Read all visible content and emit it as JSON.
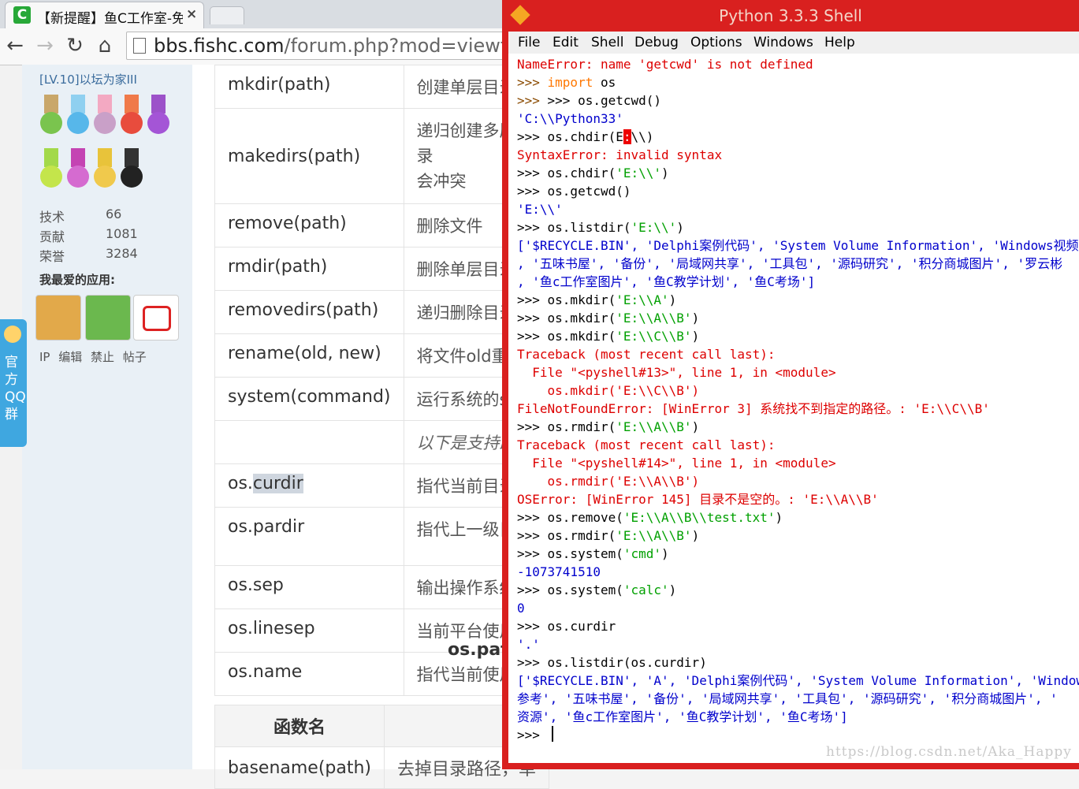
{
  "browser": {
    "tab": {
      "icon": "C",
      "title": "【新提醒】鱼C工作室-免费",
      "close": "×"
    },
    "toolbar": {
      "back": "←",
      "forward": "→",
      "reload": "↻",
      "home": "⌂"
    },
    "url": {
      "host": "bbs.fishc.com",
      "path": "/forum.php?mod=viewthread"
    }
  },
  "sidebar": {
    "level": "[LV.10]以坛为家III",
    "stats": [
      {
        "label": "技术",
        "value": "66"
      },
      {
        "label": "贡献",
        "value": "1081"
      },
      {
        "label": "荣誉",
        "value": "3284"
      }
    ],
    "apps_heading": "我最爱的应用:",
    "links": "IP 编辑 禁止 帖子",
    "qq_label": "官方QQ群"
  },
  "main": {
    "rows": [
      {
        "name": "mkdir(path)",
        "desc": "创建单层目录"
      },
      {
        "name": "makedirs(path)",
        "desc": "递归创建多层目录"
      },
      {
        "name": "remove(path)",
        "desc": "删除文件"
      },
      {
        "name": "rmdir(path)",
        "desc": "删除单层目录"
      },
      {
        "name": "removedirs(path)",
        "desc": "递归删除目录"
      },
      {
        "name": "rename(old, new)",
        "desc": "将文件old重命名"
      },
      {
        "name": "system(command)",
        "desc": "运行系统的shell"
      },
      {
        "name": "",
        "desc": "以下是支持路径"
      },
      {
        "name_prefix": "os.",
        "name_hl": "curdir",
        "desc": "指代当前目录"
      },
      {
        "name": "os.pardir",
        "desc": "指代上一级目录"
      },
      {
        "name": "os.sep",
        "desc": "输出操作系统特"
      },
      {
        "name": "os.linesep",
        "desc": "当前平台使用的"
      },
      {
        "name": "os.name",
        "desc": "指代当前使用的"
      }
    ],
    "section_label": "os.pat",
    "table2": {
      "header_name": "函数名",
      "row_name": "basename(path)",
      "row_desc": "去掉目录路径，单"
    }
  },
  "shell": {
    "title": "Python 3.3.3 Shell",
    "menu": [
      "File",
      "Edit",
      "Shell",
      "Debug",
      "Options",
      "Windows",
      "Help"
    ],
    "lines": {
      "l0": "NameError: name 'getcwd' is not defined",
      "l1a": ">>> ",
      "l1b": "import",
      "l1c": " os",
      "l2": ">>> os.getcwd()",
      "l3": "'C:\\\\Python33'",
      "l4a": ">>> os.chdir(E",
      "l4b": ":",
      "l4c": "\\\\)",
      "l5": "SyntaxError: invalid syntax",
      "l6a": ">>> os.chdir(",
      "l6b": "'E:\\\\'",
      "l6c": ")",
      "l7": ">>> os.getcwd()",
      "l8": "'E:\\\\'",
      "l9a": ">>> os.listdir(",
      "l9b": "'E:\\\\'",
      "l9c": ")",
      "l10": "['$RECYCLE.BIN', 'Delphi案例代码', 'System Volume Information', 'Windows视频教",
      "l11": ", '五味书屋', '备份', '局域网共享', '工具包', '源码研究', '积分商城图片', '罗云彬",
      "l12": ", '鱼c工作室图片', '鱼C教学计划', '鱼C考场']",
      "l13a": ">>> os.mkdir(",
      "l13b": "'E:\\\\A'",
      "l13c": ")",
      "l14a": ">>> os.mkdir(",
      "l14b": "'E:\\\\A\\\\B'",
      "l14c": ")",
      "l15a": ">>> os.mkdir(",
      "l15b": "'E:\\\\C\\\\B'",
      "l15c": ")",
      "l16": "Traceback (most recent call last):",
      "l17": "  File \"<pyshell#13>\", line 1, in <module>",
      "l18": "    os.mkdir('E:\\\\C\\\\B')",
      "l19": "FileNotFoundError: [WinError 3] 系统找不到指定的路径。: 'E:\\\\C\\\\B'",
      "l20a": ">>> os.rmdir(",
      "l20b": "'E:\\\\A\\\\B'",
      "l20c": ")",
      "l21": "Traceback (most recent call last):",
      "l22": "  File \"<pyshell#14>\", line 1, in <module>",
      "l23": "    os.rmdir('E:\\\\A\\\\B')",
      "l24": "OSError: [WinError 145] 目录不是空的。: 'E:\\\\A\\\\B'",
      "l25a": ">>> os.remove(",
      "l25b": "'E:\\\\A\\\\B\\\\test.txt'",
      "l25c": ")",
      "l26a": ">>> os.rmdir(",
      "l26b": "'E:\\\\A\\\\B'",
      "l26c": ")",
      "l27a": ">>> os.system(",
      "l27b": "'cmd'",
      "l27c": ")",
      "l28": "-1073741510",
      "l29a": ">>> os.system(",
      "l29b": "'calc'",
      "l29c": ")",
      "l30": "0",
      "l31": ">>> os.curdir",
      "l32": "'.'",
      "l33": ">>> os.listdir(os.curdir)",
      "l34": "['$RECYCLE.BIN', 'A', 'Delphi案例代码', 'System Volume Information', 'Windows",
      "l35": "参考', '五味书屋', '备份', '局域网共享', '工具包', '源码研究', '积分商城图片', '",
      "l36": "资源', '鱼c工作室图片', '鱼C教学计划', '鱼C考场']",
      "l37": ">>> "
    }
  },
  "watermark": "https://blog.csdn.net/Aka_Happy"
}
